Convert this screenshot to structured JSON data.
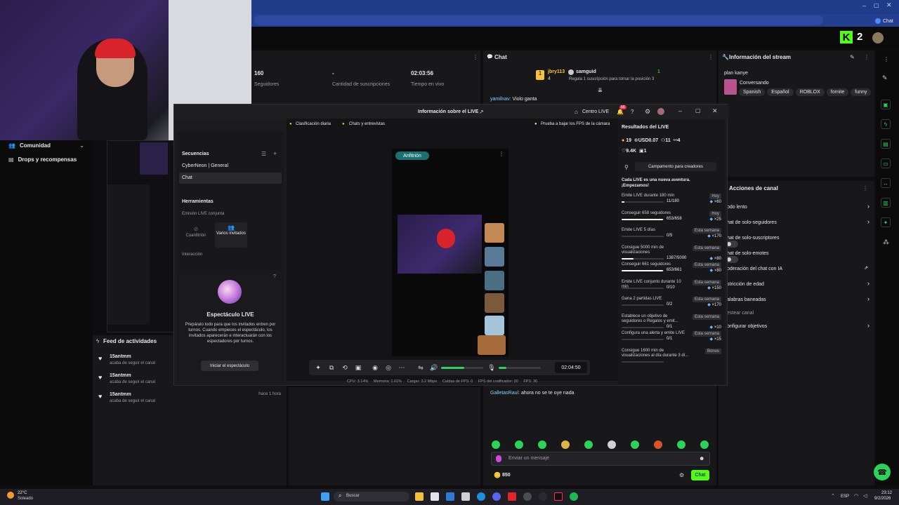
{
  "header": {
    "k_number": "2",
    "chat_tab": "Chat"
  },
  "stats": [
    {
      "value": "160",
      "label": "Seguidores"
    },
    {
      "value": "-",
      "label": "Cantidad de suscripciones"
    },
    {
      "value": "02:03:56",
      "label": "Tiempo en vivo"
    }
  ],
  "chat": {
    "title": "Chat",
    "top_user": "jbry113",
    "top_user_count": "4",
    "second_user": "samguid",
    "second_count": "1",
    "gift_note": "Regala 1 suscripción para tomar la posición 3",
    "messages": [
      {
        "user": "yamilnav:",
        "text": "Violo ganta"
      },
      {
        "user": "GalletasRaul:",
        "text": "ahora no se te oye nada"
      }
    ],
    "input_placeholder": "Enviar un mensaje",
    "coins": "850",
    "send_label": "Chat"
  },
  "stream_info": {
    "title": "Información del stream",
    "streamer": "plan kanye",
    "category": "Conversando",
    "tags": [
      "Spanish",
      "Español",
      "ROBLOX",
      "fornite",
      "funny"
    ]
  },
  "channel_actions": {
    "title": "Acciones de canal",
    "items": [
      {
        "label": "odo lento",
        "control": "arrow"
      },
      {
        "label": "hat de solo-seguidores",
        "control": "arrow"
      },
      {
        "label": "hat de solo-suscriptores",
        "control": "toggle"
      },
      {
        "label": "hat de solo-emotes",
        "control": "toggle"
      },
      {
        "label": "oderación del chat con IA",
        "control": "external"
      },
      {
        "label": "stricción de edad",
        "control": "arrow"
      },
      {
        "label": "alabras baneadas",
        "control": "arrow"
      },
      {
        "label": "estear canal",
        "control": "none"
      },
      {
        "label": "onfigurar objetivos",
        "control": "arrow"
      }
    ]
  },
  "sidebar": {
    "items": [
      {
        "label": "Comunidad"
      },
      {
        "label": "Drops y recompensas"
      }
    ]
  },
  "activity": {
    "title": "Feed de actividades",
    "items": [
      {
        "user": "15antmm",
        "action": "acaba de seguir el canal",
        "time": ""
      },
      {
        "user": "15antmm",
        "action": "acaba de seguir el canal",
        "time": ""
      },
      {
        "user": "15antmm",
        "action": "acaba de seguir el canal",
        "time": "hace 1 hora"
      }
    ]
  },
  "modal": {
    "title": "Información sobre el LIVE",
    "centro_live": "Centro LIVE",
    "notif_count": "66",
    "chip_ranking": "Clasificación diaria",
    "chip_chats": "Chats y entrevistas",
    "fps_hint": "Prueba a bajar los FPS de la cámara",
    "sequences_title": "Secuencias",
    "sequence_items": [
      "CyberNeon | General",
      "Chat"
    ],
    "tools_title": "Herramientas",
    "joint_live": "Emisión LIVE conjunta",
    "cohost": "Coanfitrión",
    "multi_guest": "Varios invitados",
    "interaction": "Interacción",
    "show_title": "Espectáculo LIVE",
    "show_desc": "Prepáralo todo para que los invitados entren por turnos. Cuando empieces el espectáculo, los invitados aparecerán e interactuarán con los espectadores por turnos.",
    "show_button": "Iniciar el espectáculo",
    "host_badge": "Anfitrión",
    "timer": "02:04:50",
    "mic_level": 0.55,
    "input_level": 0.18,
    "status": {
      "cpu": "CPU: 3.14%",
      "memory": "Memoria: 1.61%",
      "upload": "Cargar: 3.2 Mbps",
      "fps_drops": "Caídas de FPS: 0",
      "encoder_fps": "FPS del codificador: 30",
      "fps": "FPS: 30"
    }
  },
  "results": {
    "title": "Resultados del LIVE",
    "coins": "19",
    "usd": "USD0.07",
    "viewers": "11",
    "shares": "4",
    "likes": "9.4K",
    "gifts": "1",
    "campaign": "Campamento para creadores",
    "intro": "Cada LIVE es una nueva aventura. ¡Empezamos!",
    "goals": [
      {
        "label": "Emite LIVE durante 180 min",
        "tag": "Hoy",
        "progress_text": "11/180",
        "progress": 0.06,
        "reward": "×60"
      },
      {
        "label": "Conseguir 658 seguidores",
        "tag": "Hoy",
        "progress_text": "653/658",
        "progress": 0.99,
        "reward": "×25"
      },
      {
        "label": "Emite LIVE 5 días",
        "tag": "Esta semana",
        "progress_text": "0/5",
        "progress": 0.0,
        "reward": "×170"
      },
      {
        "label": "Consigue 5000 min de visualizaciones",
        "tag": "Esta semana",
        "progress_text": "1387/5000",
        "progress": 0.28,
        "reward": "×80"
      },
      {
        "label": "Conseguir 661 seguidores",
        "tag": "Esta semana",
        "progress_text": "653/661",
        "progress": 0.99,
        "reward": "×80"
      },
      {
        "label": "Emite LIVE conjunto durante 10 min",
        "tag": "Esta semana",
        "progress_text": "0/10",
        "progress": 0.0,
        "reward": "×150"
      },
      {
        "label": "Gana 2 partidas LIVE",
        "tag": "Esta semana",
        "progress_text": "0/2",
        "progress": 0.0,
        "reward": "×170"
      },
      {
        "label": "Establece un objetivo de seguidores o Regalos y emit...",
        "tag": "Esta semana",
        "progress_text": "0/1",
        "progress": 0.0,
        "reward": "×10"
      },
      {
        "label": "Configura una alerta y emite LIVE",
        "tag": "Esta semana",
        "progress_text": "0/1",
        "progress": 0.0,
        "reward": "×15"
      },
      {
        "label": "Consigue 1600 min de visualizaciones al día durante 3 dí...",
        "tag": "Bonus",
        "progress_text": "",
        "progress": 0.0,
        "reward": ""
      }
    ]
  },
  "taskbar": {
    "weather_temp": "22°C",
    "weather_desc": "Soleado",
    "search": "Buscar",
    "lang": "ESP",
    "time": "23:12",
    "date": "9/2/2026"
  },
  "colors": {
    "accent": "#53fc18",
    "brand": "#1f3c8a",
    "bg": "#0e0e10",
    "panel": "#18181b"
  }
}
